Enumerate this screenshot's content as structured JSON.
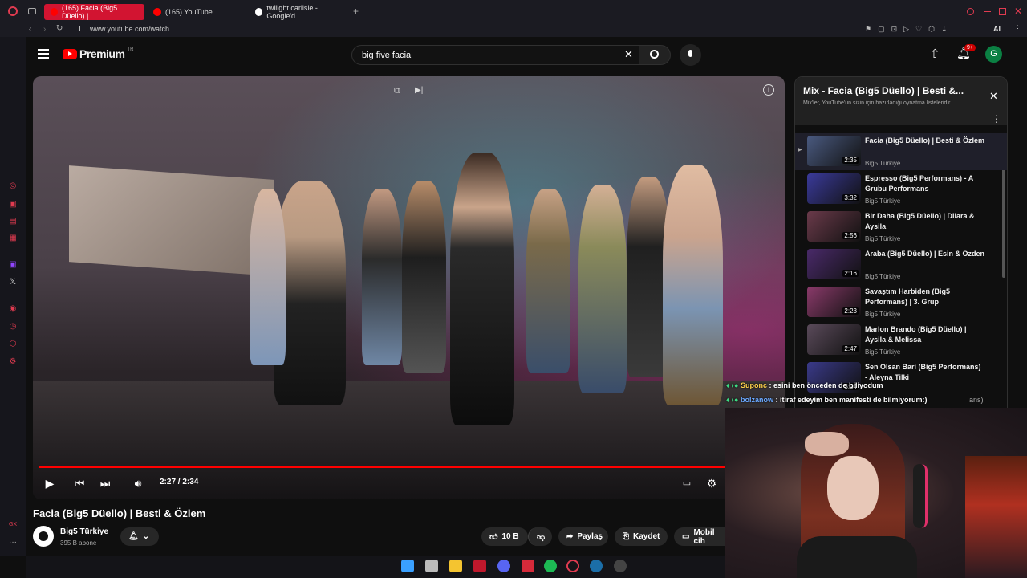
{
  "browser": {
    "tabs": [
      {
        "label": "(165) Facia (Big5 Düello) |",
        "active": true
      },
      {
        "label": "(165) YouTube",
        "active": false
      },
      {
        "label": "twilight carlisle - Google'd",
        "active": false
      }
    ],
    "url": "www.youtube.com/watch",
    "extension_badge": "AI"
  },
  "yt": {
    "logo_text": "Premium",
    "logo_region": "TR",
    "search_value": "big five facia",
    "notification_count": "9+",
    "avatar_letter": "G"
  },
  "player": {
    "time": "2:27 / 2:34",
    "progress": 0.957
  },
  "video": {
    "title": "Facia (Big5 Düello) | Besti & Özlem",
    "channel": "Big5 Türkiye",
    "subscribers": "395 B abone",
    "likes": "10 B",
    "share_label": "Paylaş",
    "save_label": "Kaydet",
    "mobile_label": "Mobil cih"
  },
  "mix": {
    "title": "Mix - Facia (Big5 Düello) | Besti &...",
    "subtitle": "Mix'ler, YouTube'un sizin için hazırladığı oynatma listeleridir",
    "items": [
      {
        "title": "Facia (Big5 Düello) | Besti & Özlem",
        "channel": "Big5 Türkiye",
        "duration": "2:35",
        "color": "#4a5a80"
      },
      {
        "title": "Espresso (Big5 Performans) - A Grubu Performans",
        "channel": "Big5 Türkiye",
        "duration": "3:32",
        "color": "#3a3a9a"
      },
      {
        "title": "Bir Daha (Big5 Düello) | Dilara & Aysila",
        "channel": "Big5 Türkiye",
        "duration": "2:56",
        "color": "#6a3a4a"
      },
      {
        "title": "Araba (Big5 Düello) | Esin & Özden",
        "channel": "Big5 Türkiye",
        "duration": "2:16",
        "color": "#4a2a6a"
      },
      {
        "title": "Savaştım Harbiden (Big5 Performans) | 3. Grup",
        "channel": "Big5 Türkiye",
        "duration": "2:23",
        "color": "#8a3a6a"
      },
      {
        "title": "Marlon Brando (Big5 Düello) | Aysila & Melissa",
        "channel": "Big5 Türkiye",
        "duration": "2:47",
        "color": "#5a4a5a"
      },
      {
        "title": "Sen Olsan Bari (Big5 Performans) - Aleyna Tilki",
        "channel": "",
        "duration": "3:04",
        "color": "#3a3a8a"
      }
    ],
    "partial_text": "ans)"
  },
  "chat": [
    {
      "user": "Suponc",
      "message": ": esini ben önceden de biliyodum",
      "user_color": "#ffd24a"
    },
    {
      "user": "bolzanow",
      "message": ": itiraf edeyim ben manifesti de bilmiyorum:)",
      "user_color": "#6aa8ff"
    }
  ],
  "colors": {
    "youtube_red": "#ff0000",
    "opera_red": "#d21431"
  }
}
